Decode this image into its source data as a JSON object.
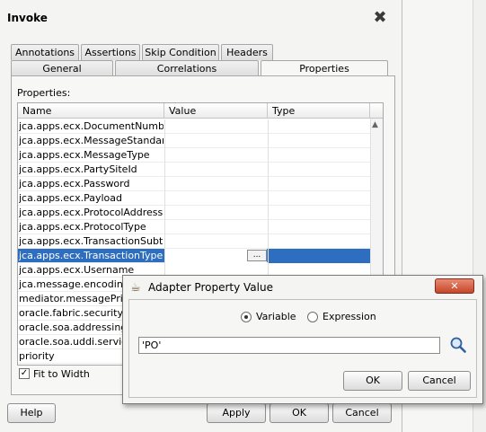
{
  "dialog": {
    "title": "Invoke",
    "tabs_row1": [
      "Annotations",
      "Assertions",
      "Skip Condition",
      "Headers"
    ],
    "tabs_row2": [
      "General",
      "Correlations",
      "Properties"
    ],
    "active_tab": "Properties",
    "properties_label": "Properties:",
    "table": {
      "columns": [
        "Name",
        "Value",
        "Type"
      ],
      "rows": [
        "jca.apps.ecx.DocumentNumber",
        "jca.apps.ecx.MessageStandard",
        "jca.apps.ecx.MessageType",
        "jca.apps.ecx.PartySiteId",
        "jca.apps.ecx.Password",
        "jca.apps.ecx.Payload",
        "jca.apps.ecx.ProtocolAddress",
        "jca.apps.ecx.ProtocolType",
        "jca.apps.ecx.TransactionSubt...",
        "jca.apps.ecx.TransactionType",
        "jca.apps.ecx.Username",
        "jca.message.encoding",
        "mediator.messagePriority",
        "oracle.fabric.security.id",
        "oracle.soa.addressing.r",
        "oracle.soa.uddi.service",
        "priority"
      ],
      "selected_row": "jca.apps.ecx.TransactionType",
      "ellipsis_label": "..."
    },
    "fit_to_width_label": "Fit to Width",
    "fit_to_width_checked": "✓",
    "buttons": {
      "help": "Help",
      "apply": "Apply",
      "ok": "OK",
      "cancel": "Cancel"
    }
  },
  "popup": {
    "title": "Adapter Property Value",
    "radio_variable": "Variable",
    "radio_expression": "Expression",
    "selected_radio": "Variable",
    "value": "'PO'",
    "buttons": {
      "ok": "OK",
      "cancel": "Cancel"
    },
    "close_glyph": "✕"
  },
  "icons": {
    "close": "close-icon",
    "search": "search-icon",
    "coffee": "coffee-cup-icon"
  },
  "colors": {
    "selection": "#2e6ec0",
    "popup_close": "#c4462b"
  }
}
